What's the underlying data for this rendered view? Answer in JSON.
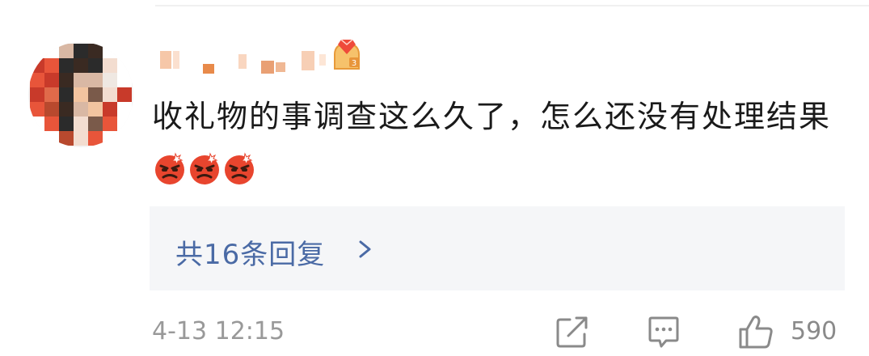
{
  "comment": {
    "text": "收礼物的事调查这么久了，怎么还没有处理结果",
    "emojis": [
      "angry-face-icon",
      "angry-face-icon",
      "angry-face-icon"
    ],
    "replies_link": "共16条回复",
    "timestamp": "4-13 12:15",
    "like_count": "590"
  },
  "colors": {
    "link": "#4a6aa5",
    "meta": "#999999",
    "reply_bg": "#f5f6f8",
    "badge": "#f2a84b"
  },
  "icons": {
    "badge": "user-badge-icon",
    "share": "share-icon",
    "comment": "comment-icon",
    "like": "thumbs-up-icon"
  }
}
